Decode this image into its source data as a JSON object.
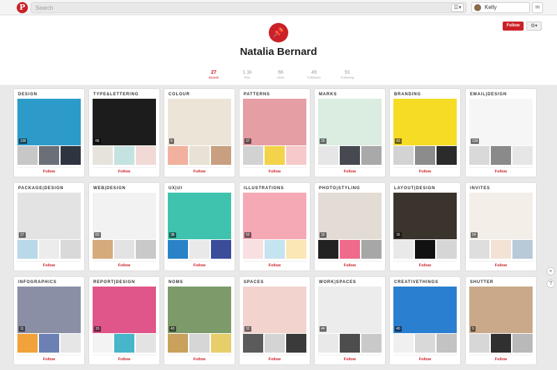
{
  "topbar": {
    "logo_letter": "P",
    "search_placeholder": "Search",
    "menu_glyph": "☰▾",
    "user_name": "Kelly",
    "notif_glyph": "✉"
  },
  "profile": {
    "follow_label": "Follow",
    "settings_glyph": "⚙▾",
    "pin_glyph": "📌",
    "name": "Natalia Bernard",
    "stats": [
      {
        "count": "27",
        "label": "Boards"
      },
      {
        "count": "1.1k",
        "label": "Pins"
      },
      {
        "count": "66",
        "label": "Likes"
      },
      {
        "count": "49",
        "label": "Followers"
      },
      {
        "count": "91",
        "label": "Following"
      }
    ]
  },
  "follow_label": "Follow",
  "boards": [
    {
      "title": "DESIGN",
      "count": "136",
      "cover": "#2c9bc9",
      "thumbs": [
        "#c7c7c7",
        "#6b7078",
        "#2e3540"
      ]
    },
    {
      "title": "TYPE&LETTERING",
      "count": "66",
      "cover": "#1c1c1c",
      "thumbs": [
        "#e6e3dc",
        "#c4e2e0",
        "#f1d9d5"
      ]
    },
    {
      "title": "COLOUR",
      "count": "8",
      "cover": "#ede4d8",
      "thumbs": [
        "#f2b19e",
        "#e8e1d6",
        "#c8a080"
      ]
    },
    {
      "title": "PATTERNS",
      "count": "37",
      "cover": "#e59ea3",
      "thumbs": [
        "#d2d2d2",
        "#f2d34a",
        "#f6c9cb"
      ]
    },
    {
      "title": "MARKS",
      "count": "25",
      "cover": "#dbece0",
      "thumbs": [
        "#e6e6e6",
        "#464a50",
        "#a9a9a9"
      ]
    },
    {
      "title": "BRANDING",
      "count": "43",
      "cover": "#f6dc25",
      "thumbs": [
        "#d3d3d3",
        "#8c8c8c",
        "#2b2b2b"
      ]
    },
    {
      "title": "EMAIL|DESIGN",
      "count": "139",
      "cover": "#f6f6f6",
      "thumbs": [
        "#d9d9d9",
        "#8a8a8a",
        "#e6e6e6"
      ]
    },
    {
      "title": "PACKAGE|DESIGN",
      "count": "27",
      "cover": "#e3e3e3",
      "thumbs": [
        "#b9d8e8",
        "#ececec",
        "#d9d9d9"
      ]
    },
    {
      "title": "WEB|DESIGN",
      "count": "60",
      "cover": "#f2f2f2",
      "thumbs": [
        "#d5ab7c",
        "#e3e3e3",
        "#c9c9c9"
      ]
    },
    {
      "title": "UX|UI",
      "count": "38",
      "cover": "#3fc3ae",
      "thumbs": [
        "#2a83c6",
        "#e9e9e9",
        "#3a4c9a"
      ]
    },
    {
      "title": "ILLUSTRATIONS",
      "count": "50",
      "cover": "#f5a9b5",
      "thumbs": [
        "#f7dfe2",
        "#c4e4f0",
        "#fbe7b5"
      ]
    },
    {
      "title": "PHOTO|STYLING",
      "count": "16",
      "cover": "#e2dcd4",
      "thumbs": [
        "#222222",
        "#f06a8b",
        "#a7a7a7"
      ]
    },
    {
      "title": "LAYOUT|DESIGN",
      "count": "16",
      "cover": "#3a342d",
      "thumbs": [
        "#e9e9e9",
        "#111111",
        "#d6d6d6"
      ]
    },
    {
      "title": "INVITES",
      "count": "54",
      "cover": "#f3efe8",
      "thumbs": [
        "#dedede",
        "#f2e3d5",
        "#b8c9d8"
      ]
    },
    {
      "title": "INFOGRAPHICS",
      "count": "11",
      "cover": "#8b8fa6",
      "thumbs": [
        "#f2a23a",
        "#6c80b3",
        "#e6e6e6"
      ]
    },
    {
      "title": "REPORT|DESIGN",
      "count": "15",
      "cover": "#e0558a",
      "thumbs": [
        "#f3f3f3",
        "#47b6c9",
        "#e3e3e3"
      ]
    },
    {
      "title": "NOMS",
      "count": "43",
      "cover": "#7c9a6a",
      "thumbs": [
        "#c9a15c",
        "#d6d6d6",
        "#e6cf6a"
      ]
    },
    {
      "title": "SPACES",
      "count": "32",
      "cover": "#f2d3ce",
      "thumbs": [
        "#5b5b5b",
        "#d4d4d4",
        "#3a3a3a"
      ]
    },
    {
      "title": "WORK|SPACES",
      "count": "44",
      "cover": "#ececec",
      "thumbs": [
        "#e9e9e9",
        "#4d4d4d",
        "#c9c9c9"
      ]
    },
    {
      "title": "CREATIVETHINGS",
      "count": "40",
      "cover": "#2b7fd0",
      "thumbs": [
        "#f0f0f0",
        "#d9d9d9",
        "#c3c3c3"
      ]
    },
    {
      "title": "SHUTTER",
      "count": "9",
      "cover": "#c9a98a",
      "thumbs": [
        "#d7d7d7",
        "#303030",
        "#b9b9b9"
      ]
    }
  ],
  "side_buttons": [
    "+",
    "?"
  ]
}
